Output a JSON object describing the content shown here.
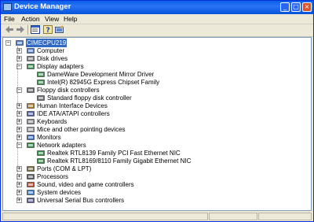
{
  "window": {
    "title": "Device Manager"
  },
  "menu": [
    {
      "label": "File"
    },
    {
      "label": "Action"
    },
    {
      "label": "View"
    },
    {
      "label": "Help"
    }
  ],
  "toolbar": {
    "buttons": [
      "back-icon",
      "forward-icon",
      "properties-icon",
      "help-icon",
      "scan-hardware-icon"
    ]
  },
  "tree": {
    "root": "CIMECPU219",
    "items": [
      {
        "label": "Computer",
        "expanded": false,
        "icon": "computer-icon"
      },
      {
        "label": "Disk drives",
        "expanded": false,
        "icon": "disk-drive-icon"
      },
      {
        "label": "Display adapters",
        "expanded": true,
        "icon": "display-adapter-icon",
        "children": [
          "DameWare Development Mirror Driver",
          "Intel(R) 82945G Express Chipset Family"
        ]
      },
      {
        "label": "Floppy disk controllers",
        "expanded": true,
        "icon": "floppy-controller-icon",
        "children": [
          "Standard floppy disk controller"
        ]
      },
      {
        "label": "Human Interface Devices",
        "expanded": false,
        "icon": "hid-icon"
      },
      {
        "label": "IDE ATA/ATAPI controllers",
        "expanded": false,
        "icon": "ide-controller-icon"
      },
      {
        "label": "Keyboards",
        "expanded": false,
        "icon": "keyboard-icon"
      },
      {
        "label": "Mice and other pointing devices",
        "expanded": false,
        "icon": "mouse-icon"
      },
      {
        "label": "Monitors",
        "expanded": false,
        "icon": "monitor-icon"
      },
      {
        "label": "Network adapters",
        "expanded": true,
        "icon": "network-adapter-icon",
        "children": [
          "Realtek RTL8139 Family PCI Fast Ethernet NIC",
          "Realtek RTL8169/8110 Family Gigabit Ethernet NIC"
        ]
      },
      {
        "label": "Ports (COM & LPT)",
        "expanded": false,
        "icon": "port-icon"
      },
      {
        "label": "Processors",
        "expanded": false,
        "icon": "processor-icon"
      },
      {
        "label": "Sound, video and game controllers",
        "expanded": false,
        "icon": "sound-icon"
      },
      {
        "label": "System devices",
        "expanded": false,
        "icon": "system-device-icon"
      },
      {
        "label": "Universal Serial Bus controllers",
        "expanded": false,
        "icon": "usb-icon"
      }
    ]
  },
  "colors": {
    "selection": "#316ac5",
    "titlebar": "#0a5ee8"
  }
}
